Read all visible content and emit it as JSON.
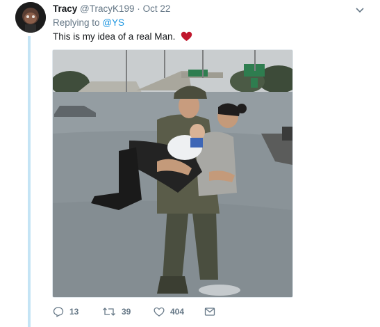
{
  "tweet": {
    "display_name": "Tracy",
    "handle": "@TracyK199",
    "separator": "·",
    "date": "Oct 22",
    "replying_prefix": "Replying to",
    "replying_handle": "@YS",
    "text": "This is my idea of a real Man.",
    "emoji": "heart-emoji",
    "photo_alt": "flood rescue photo"
  },
  "actions": {
    "reply_count": "13",
    "retweet_count": "39",
    "like_count": "404"
  },
  "colors": {
    "thread_line": "#c4e4f5",
    "link": "#1b95e0",
    "muted": "#657786",
    "heart": "#c0172d"
  },
  "icons": [
    "chevron-down-icon",
    "reply-icon",
    "retweet-icon",
    "like-icon",
    "dm-icon",
    "heart-icon"
  ]
}
